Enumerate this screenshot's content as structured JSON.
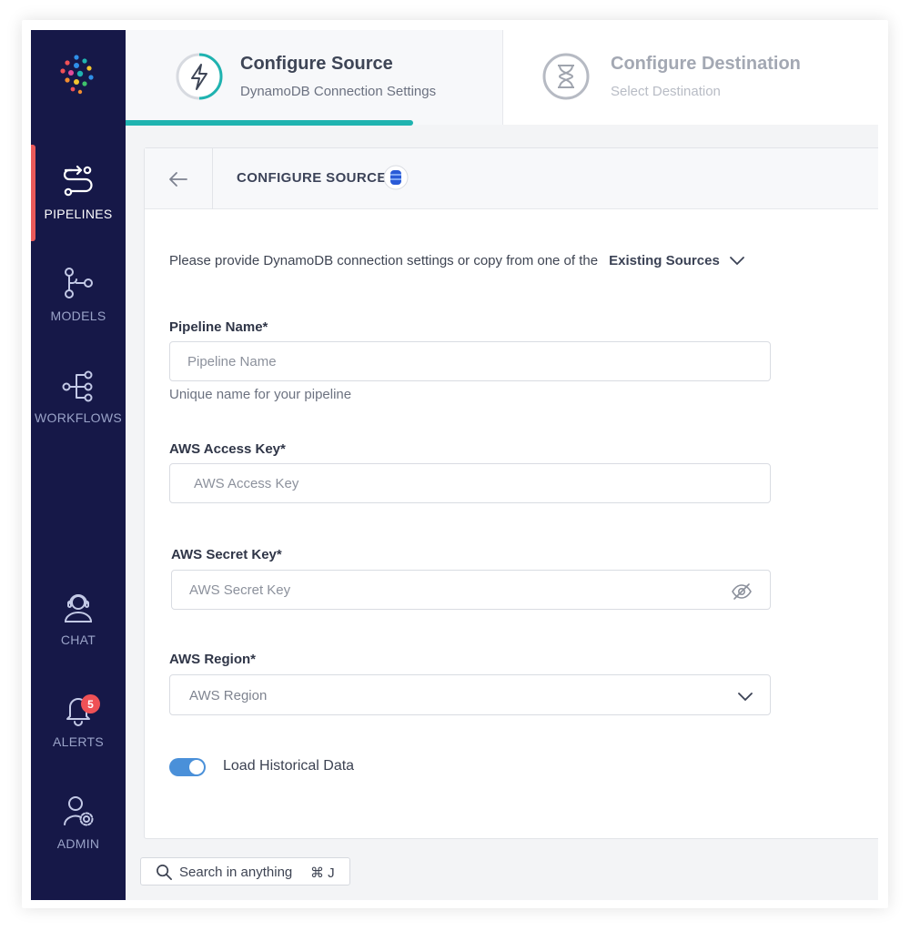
{
  "sidebar": {
    "items": [
      {
        "label": "PIPELINES",
        "icon": "pipelines-icon",
        "active": true
      },
      {
        "label": "MODELS",
        "icon": "models-icon"
      },
      {
        "label": "WORKFLOWS",
        "icon": "workflows-icon"
      },
      {
        "label": "CHAT",
        "icon": "chat-icon"
      },
      {
        "label": "ALERTS",
        "icon": "bell-icon",
        "badge": "5"
      },
      {
        "label": "ADMIN",
        "icon": "admin-icon"
      }
    ]
  },
  "steps": [
    {
      "title": "Configure Source",
      "subtitle": "DynamoDB Connection Settings",
      "icon": "lightning-icon",
      "active": true
    },
    {
      "title": "Configure Destination",
      "subtitle": "Select Destination",
      "icon": "hourglass-icon",
      "active": false
    }
  ],
  "card": {
    "title": "CONFIGURE SOURCE",
    "intro": "Please provide DynamoDB connection settings or copy from one of the",
    "existing_sources": "Existing Sources"
  },
  "form": {
    "pipeline_name": {
      "label": "Pipeline Name*",
      "placeholder": "Pipeline Name",
      "help": "Unique name for your pipeline"
    },
    "access_key": {
      "label": "AWS Access Key*",
      "placeholder": "AWS Access Key"
    },
    "secret_key": {
      "label": "AWS Secret Key*",
      "placeholder": "AWS Secret Key"
    },
    "region": {
      "label": "AWS Region*",
      "placeholder": "AWS Region"
    },
    "historical": {
      "label": "Load Historical Data",
      "enabled": true
    }
  },
  "search": {
    "placeholder": "Search in anything",
    "shortcut": "⌘ J"
  },
  "colors": {
    "sidebar": "#161848",
    "accent": "#1fb3b0",
    "toggle": "#4a90d9",
    "badge": "#ef5156"
  }
}
